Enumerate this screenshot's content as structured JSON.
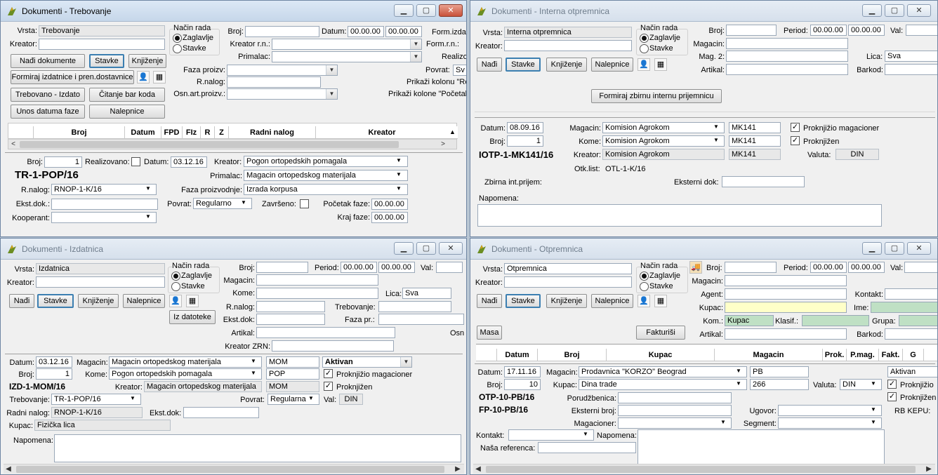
{
  "w1": {
    "title": "Dokumenti - Trebovanje",
    "vrsta_label": "Vrsta:",
    "vrsta": "Trebovanje",
    "kreator_label": "Kreator:",
    "nacin_rada": "Način rada",
    "zaglavlje": "Zaglavlje",
    "stavke": "Stavke",
    "broj_label": "Broj:",
    "datum_label": "Datum:",
    "datum1": "00.00.00",
    "datum2": "00.00.00",
    "form_izd": "Form.izda",
    "kreator_rn_label": "Kreator r.n.:",
    "form_rn": "Form.r.n.:",
    "primalac_label": "Primalac:",
    "realizo": "Realizo",
    "nadji_dok": "Nađi dokumente",
    "stavke_btn": "Stavke",
    "knjizenje": "Knjiženje",
    "formiraj": "Formiraj izdatnice i pren.dostavnice",
    "faza_proizv": "Faza proizv:",
    "r_nalog": "R.nalog:",
    "osn_art": "Osn.art.proizv.:",
    "povrat_label": "Povrat:",
    "povrat_val": "Sv",
    "prikazi1": "Prikaži kolonu \"Re",
    "prikazi2": "Prikaži kolone \"Početak",
    "trebovano": "Trebovano - Izdato",
    "citanje": "Čitanje bar koda",
    "unos_datuma": "Unos datuma faze",
    "nalepnice": "Nalepnice",
    "cols": [
      "Broj",
      "Datum",
      "FPD",
      "FIz",
      "R",
      "Z",
      "Radni nalog",
      "Kreator"
    ],
    "d_broj_label": "Broj:",
    "d_broj": "1",
    "realizovano": "Realizovano:",
    "d_datum_label": "Datum:",
    "d_datum": "03.12.16",
    "d_kreator_label": "Kreator:",
    "d_kreator": "Pogon ortopedskih pomagala",
    "doc_no": "TR-1-POP/16",
    "d_primalac_label": "Primalac:",
    "d_primalac": "Magacin ortopedskog materijala",
    "d_rnalog_label": "R.nalog:",
    "d_rnalog": "RNOP-1-K/16",
    "faza_proizvodnje": "Faza proizvodnje:",
    "faza_val": "Izrada korpusa",
    "ekst_dok": "Ekst.dok.:",
    "d_povrat_label": "Povrat:",
    "d_povrat": "Regularno",
    "zavrseno": "Završeno:",
    "pocetak_faze": "Početak faze:",
    "pocetak_val": "00.00.00",
    "kooperant": "Kooperant:",
    "kraj_faze": "Kraj faze:",
    "kraj_val": "00.00.00"
  },
  "w2": {
    "title": "Dokumenti - Interna otpremnica",
    "vrsta_label": "Vrsta:",
    "vrsta": "Interna otpremnica",
    "kreator_label": "Kreator:",
    "nacin_rada": "Način rada",
    "zaglavlje": "Zaglavlje",
    "stavke": "Stavke",
    "broj_label": "Broj:",
    "period_label": "Period:",
    "period1": "00.00.00",
    "period2": "00.00.00",
    "val_label": "Val:",
    "magacin_label": "Magacin:",
    "mag2_label": "Mag. 2:",
    "lica_label": "Lica:",
    "lica": "Sva",
    "artikal_label": "Artikal:",
    "barkod_label": "Barkod:",
    "nadji": "Nađi",
    "stavke_btn": "Stavke",
    "knjizenje": "Knjiženje",
    "nalepnice": "Nalepnice",
    "formiraj": "Formiraj zbirnu internu prijemnicu",
    "d_datum_label": "Datum:",
    "d_datum": "08.09.16",
    "d_magacin_label": "Magacin:",
    "d_magacin": "Komision Agrokom",
    "d_mag_code": "MK141",
    "proknjizio": "Proknjižio magacioner",
    "d_broj_label": "Broj:",
    "d_broj": "1",
    "kome_label": "Kome:",
    "kome": "Komision Agrokom",
    "kome_code": "MK141",
    "proknjizen": "Proknjižen",
    "doc_no": "IOTP-1-MK141/16",
    "d_kreator_label": "Kreator:",
    "d_kreator": "Komision Agrokom",
    "kreator_code": "MK141",
    "valuta_label": "Valuta:",
    "valuta": "DIN",
    "otk_label": "Otk.list:",
    "otk": "OTL-1-K/16",
    "zbirna": "Zbirna int.prijem:",
    "eksterni": "Eksterni dok:",
    "napomena": "Napomena:"
  },
  "w3": {
    "title": "Dokumenti - Izdatnica",
    "vrsta_label": "Vrsta:",
    "vrsta": "Izdatnica",
    "kreator_label": "Kreator:",
    "nacin_rada": "Način rada",
    "zaglavlje": "Zaglavlje",
    "stavke": "Stavke",
    "broj_label": "Broj:",
    "period_label": "Period:",
    "period1": "00.00.00",
    "period2": "00.00.00",
    "val_label": "Val:",
    "magacin_label": "Magacin:",
    "kome_label": "Kome:",
    "lica_label": "Lica:",
    "lica": "Sva",
    "rnalog_label": "R.nalog:",
    "trebovanje_label": "Trebovanje:",
    "ekst_label": "Ekst.dok:",
    "faza_label": "Faza pr.:",
    "artikal_label": "Artikal:",
    "osn": "Osn",
    "kreator_zrn": "Kreator ZRN:",
    "nadji": "Nađi",
    "stavke_btn": "Stavke",
    "knjizenje": "Knjiženje",
    "nalepnice": "Nalepnice",
    "iz_datoteke": "Iz datoteke",
    "d_datum_label": "Datum:",
    "d_datum": "03.12.16",
    "d_magacin_label": "Magacin:",
    "d_magacin": "Magacin ortopedskog materijala",
    "d_mag_code": "MOM",
    "status": "Aktivan",
    "d_broj_label": "Broj:",
    "d_broj": "1",
    "d_kome_label": "Kome:",
    "d_kome": "Pogon ortopedskih pomagala",
    "kome_code": "POP",
    "proknjizio": "Proknjižio magacioner",
    "doc_no": "IZD-1-MOM/16",
    "d_kreator_label": "Kreator:",
    "d_kreator": "Magacin ortopedskog materijala",
    "kreator_code": "MOM",
    "proknjizen": "Proknjižen",
    "d_treb_label": "Trebovanje:",
    "d_treb": "TR-1-POP/16",
    "d_povrat_label": "Povrat:",
    "d_povrat": "Regularna",
    "d_val_label": "Val:",
    "d_val": "DIN",
    "radni_label": "Radni nalog:",
    "radni": "RNOP-1-K/16",
    "d_ekst_label": "Ekst.dok:",
    "kupac_label": "Kupac:",
    "kupac": "Fizička lica",
    "napomena": "Napomena:"
  },
  "w4": {
    "title": "Dokumenti - Otpremnica",
    "vrsta_label": "Vrsta:",
    "vrsta": "Otpremnica",
    "kreator_label": "Kreator:",
    "nacin_rada": "Način rada",
    "zaglavlje": "Zaglavlje",
    "stavke": "Stavke",
    "broj_label": "Broj:",
    "period_label": "Period:",
    "period1": "00.00.00",
    "period2": "00.00.00",
    "val_label": "Val:",
    "magacin_label": "Magacin:",
    "agent_label": "Agent:",
    "kontakt_label": "Kontakt:",
    "kupac_label": "Kupac:",
    "ime_label": "Ime:",
    "kom_label": "Kom.:",
    "kom": "Kupac",
    "klasif_label": "Klasif.:",
    "grupa_label": "Grupa:",
    "artikal_label": "Artikal:",
    "barkod_label": "Barkod:",
    "nadji": "Nađi",
    "stavke_btn": "Stavke",
    "knjizenje": "Knjiženje",
    "nalepnice": "Nalepnice",
    "masa": "Masa",
    "fakturisi": "Fakturiši",
    "cols": [
      "Datum",
      "Broj",
      "Kupac",
      "Magacin",
      "Prok.",
      "P.mag.",
      "Fakt.",
      "G"
    ],
    "d_datum_label": "Datum:",
    "d_datum": "17.11.16",
    "d_magacin_label": "Magacin:",
    "d_magacin": "Prodavnica \"KORZO\" Beograd",
    "d_mag_code": "PB",
    "status": "Aktivan",
    "d_broj_label": "Broj:",
    "d_broj": "10",
    "d_kupac_label": "Kupac:",
    "d_kupac": "Dina trade",
    "kupac_code": "266",
    "valuta_label": "Valuta:",
    "valuta": "DIN",
    "proknjizio": "Proknjižio",
    "doc_no1": "OTP-10-PB/16",
    "porudzbenica": "Porudžbenica:",
    "proknjizen": "Proknjižen",
    "doc_no2": "FP-10-PB/16",
    "eksterni": "Eksterni broj:",
    "ugovor": "Ugovor:",
    "rb_kepu": "RB KEPU:",
    "magacioner": "Magacioner:",
    "segment": "Segment:",
    "kontakt2": "Kontakt:",
    "napomena": "Napomena:",
    "nasa_ref": "Naša referenca:"
  }
}
